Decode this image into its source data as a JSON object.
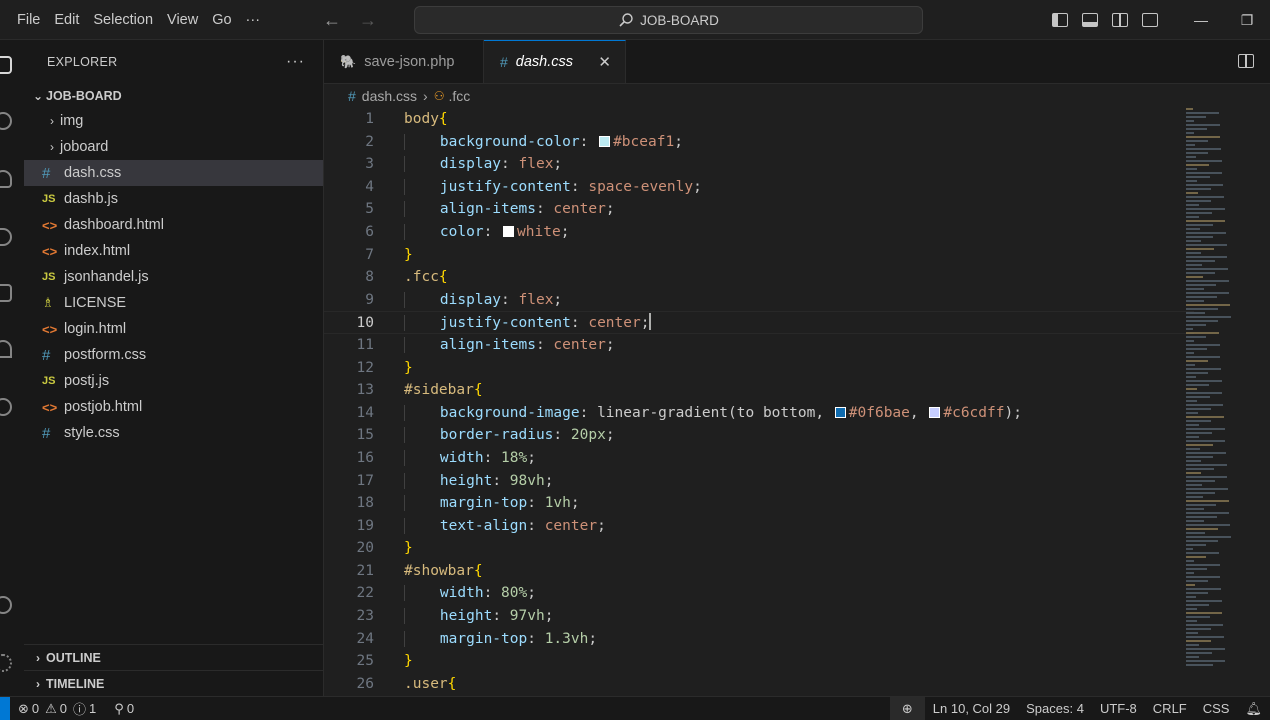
{
  "menu": {
    "file": "File",
    "edit": "Edit",
    "selection": "Selection",
    "view": "View",
    "go": "Go",
    "more": "···"
  },
  "search": {
    "label": "JOB-BOARD"
  },
  "window": {
    "minimize": "—",
    "restore": "❐"
  },
  "sidebar": {
    "title": "EXPLORER",
    "more": "···",
    "root": "JOB-BOARD",
    "folders": [
      {
        "label": "img"
      },
      {
        "label": "joboard"
      }
    ],
    "files": [
      {
        "label": "dash.css",
        "icon": "#",
        "type": "css",
        "selected": true
      },
      {
        "label": "dashb.js",
        "icon": "JS",
        "type": "js"
      },
      {
        "label": "dashboard.html",
        "icon": "<>",
        "type": "html"
      },
      {
        "label": "index.html",
        "icon": "<>",
        "type": "html"
      },
      {
        "label": "jsonhandel.js",
        "icon": "JS",
        "type": "js"
      },
      {
        "label": "LICENSE",
        "icon": "♗",
        "type": "lic"
      },
      {
        "label": "login.html",
        "icon": "<>",
        "type": "html"
      },
      {
        "label": "postform.css",
        "icon": "#",
        "type": "css"
      },
      {
        "label": "postj.js",
        "icon": "JS",
        "type": "js"
      },
      {
        "label": "postjob.html",
        "icon": "<>",
        "type": "html"
      },
      {
        "label": "style.css",
        "icon": "#",
        "type": "css"
      }
    ],
    "outline": "OUTLINE",
    "timeline": "TIMELINE"
  },
  "tabs": [
    {
      "label": "save-json.php",
      "icon": "🐘"
    },
    {
      "label": "dash.css",
      "icon": "#",
      "close": "✕"
    }
  ],
  "breadcrumb": {
    "file": "dash.css",
    "symbol": ".fcc"
  },
  "code": {
    "current_line": 10,
    "lines": [
      {
        "n": "1",
        "t": "body{"
      },
      {
        "n": "2",
        "t": "    background-color: #bceaf1;"
      },
      {
        "n": "3",
        "t": "    display: flex;"
      },
      {
        "n": "4",
        "t": "    justify-content: space-evenly;"
      },
      {
        "n": "5",
        "t": "    align-items: center;"
      },
      {
        "n": "6",
        "t": "    color: white;"
      },
      {
        "n": "7",
        "t": "}"
      },
      {
        "n": "8",
        "t": ".fcc{"
      },
      {
        "n": "9",
        "t": "    display: flex;"
      },
      {
        "n": "10",
        "t": "    justify-content: center;"
      },
      {
        "n": "11",
        "t": "    align-items: center;"
      },
      {
        "n": "12",
        "t": "}"
      },
      {
        "n": "13",
        "t": "#sidebar{"
      },
      {
        "n": "14",
        "t": "    background-image: linear-gradient(to bottom, #0f6bae, #c6cdff);"
      },
      {
        "n": "15",
        "t": "    border-radius: 20px;"
      },
      {
        "n": "16",
        "t": "    width: 18%;"
      },
      {
        "n": "17",
        "t": "    height: 98vh;"
      },
      {
        "n": "18",
        "t": "    margin-top: 1vh;"
      },
      {
        "n": "19",
        "t": "    text-align: center;"
      },
      {
        "n": "20",
        "t": "}"
      },
      {
        "n": "21",
        "t": "#showbar{"
      },
      {
        "n": "22",
        "t": "    width: 80%;"
      },
      {
        "n": "23",
        "t": "    height: 97vh;"
      },
      {
        "n": "24",
        "t": "    margin-top: 1.3vh;"
      },
      {
        "n": "25",
        "t": "}"
      },
      {
        "n": "26",
        "t": ".user{"
      }
    ],
    "swatch_colors": {
      "bceaf1": "#bceaf1",
      "white": "#ffffff",
      "0f6bae": "#0f6bae",
      "c6cdff": "#c6cdff"
    }
  },
  "status": {
    "errors": "0",
    "warnings": "0",
    "info": "1",
    "ports": "0",
    "position": "Ln 10, Col 29",
    "spaces": "Spaces: 4",
    "encoding": "UTF-8",
    "eol": "CRLF",
    "language": "CSS"
  },
  "colors": {
    "accent": "#0078d4",
    "editor_bg": "#1f1f1f",
    "sidebar_bg": "#181818"
  }
}
